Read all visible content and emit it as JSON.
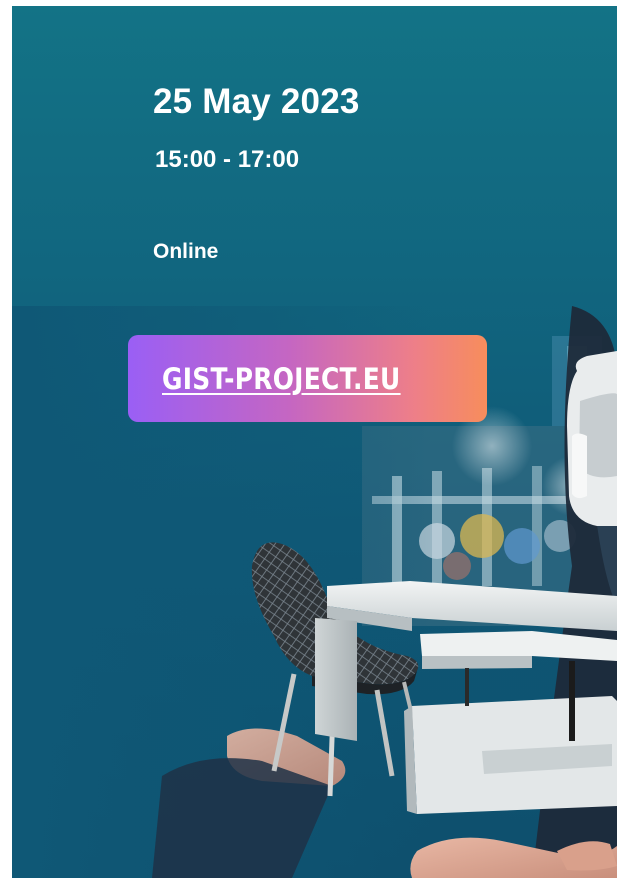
{
  "event": {
    "date": "25 May 2023",
    "time": "15:00 - 17:00",
    "location": "Online"
  },
  "cta": {
    "label": "GIST-PROJECT.EU"
  },
  "colors": {
    "background_top": "#137386",
    "background_bottom": "#0e4f6d",
    "cta_gradient_start": "#9a5ff5",
    "cta_gradient_end": "#f78d5c",
    "text": "#ffffff"
  },
  "icons": {
    "headset": "vr-headset-icon",
    "chair": "chair-icon",
    "desk": "desk-icon"
  }
}
